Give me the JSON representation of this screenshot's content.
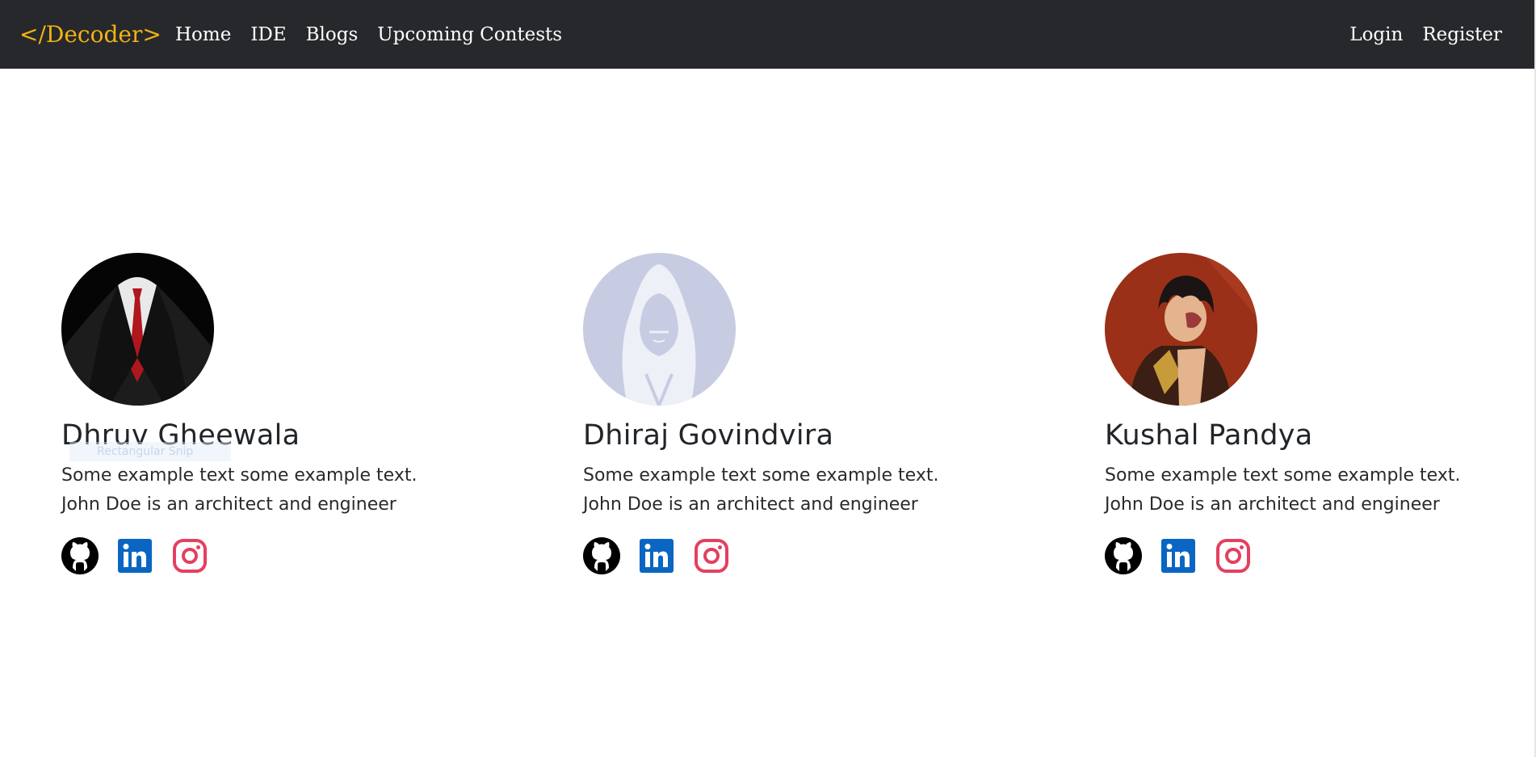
{
  "navbar": {
    "brand": "</Decoder>",
    "links": [
      {
        "label": "Home"
      },
      {
        "label": "IDE"
      },
      {
        "label": "Blogs"
      },
      {
        "label": "Upcoming Contests"
      }
    ],
    "auth": {
      "login": "Login",
      "register": "Register"
    }
  },
  "team": [
    {
      "name": "Dhruv Gheewala",
      "line1": "Some example text some example text.",
      "line2": "John Doe is an architect and engineer"
    },
    {
      "name": "Dhiraj Govindvira",
      "line1": "Some example text some example text.",
      "line2": "John Doe is an architect and engineer"
    },
    {
      "name": "Kushal Pandya",
      "line1": "Some example text some example text.",
      "line2": "John Doe is an architect and engineer"
    }
  ],
  "overlay": {
    "snip_label": "Rectangular Snip"
  },
  "colors": {
    "navbar_bg": "#26282c",
    "brand": "#f3b214",
    "github": "#000000",
    "linkedin": "#0a66c2",
    "instagram": "#e4405f"
  },
  "icons": [
    "github-icon",
    "linkedin-icon",
    "instagram-icon"
  ]
}
